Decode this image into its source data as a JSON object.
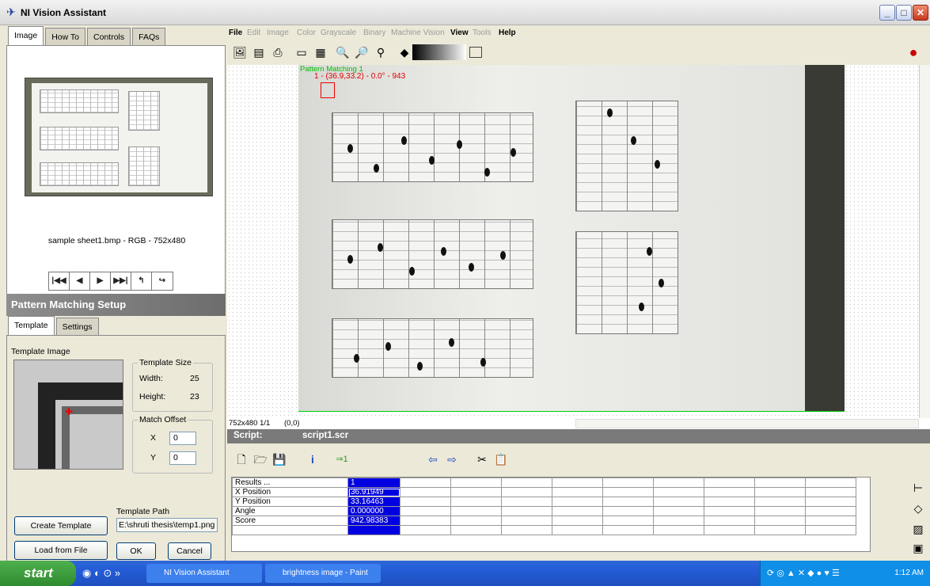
{
  "window": {
    "title": "NI Vision Assistant"
  },
  "left_tabs": [
    "Image",
    "How To",
    "Controls",
    "FAQs"
  ],
  "image_info": "sample sheet1.bmp - RGB - 752x480",
  "nav_buttons": [
    "first-icon",
    "prev-icon",
    "next-icon",
    "last-icon",
    "undo-icon",
    "redo-icon"
  ],
  "setup": {
    "title": "Pattern Matching Setup",
    "tabs": [
      "Template",
      "Settings"
    ],
    "template_image_label": "Template Image",
    "template_size": {
      "legend": "Template Size",
      "width_label": "Width:",
      "width": "25",
      "height_label": "Height:",
      "height": "23"
    },
    "match_offset": {
      "legend": "Match Offset",
      "x_label": "X",
      "x": "0",
      "y_label": "Y",
      "y": "0"
    },
    "create_template": "Create Template",
    "load_from_file": "Load from File",
    "template_path_label": "Template Path",
    "template_path": "E:\\shruti thesis\\temp1.png",
    "ok": "OK",
    "cancel": "Cancel"
  },
  "menu": [
    "File",
    "Edit",
    "Image",
    "Color",
    "Grayscale",
    "Binary",
    "Machine Vision",
    "View",
    "Tools",
    "Help"
  ],
  "menu_enabled": [
    "File",
    "View",
    "Help"
  ],
  "overlay": {
    "label": "Pattern Matching 1",
    "match": "1 - (36.9,33.2) - 0.0° - 943"
  },
  "status": {
    "size": "752x480 1/1",
    "coords": "(0,0)"
  },
  "script": {
    "label": "Script:",
    "file": "script1.scr",
    "step": "1"
  },
  "results": {
    "rows": [
      {
        "name": "Results ...",
        "value": "1"
      },
      {
        "name": "X Position",
        "value": "36.91949"
      },
      {
        "name": "Y Position",
        "value": "33.16463"
      },
      {
        "name": "Angle",
        "value": "0.000000"
      },
      {
        "name": "Score",
        "value": "942.98383"
      }
    ]
  },
  "taskbar": {
    "start": "start",
    "tasks": [
      "NI Vision Assistant",
      "brightness image - Paint"
    ],
    "clock": "1:12 AM"
  }
}
